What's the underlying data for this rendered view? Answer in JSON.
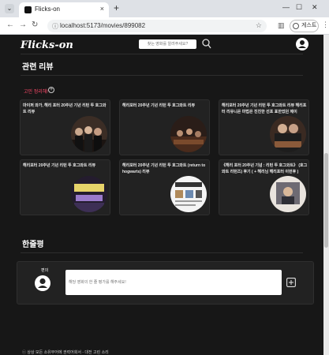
{
  "browser": {
    "tab_title": "Flicks-on",
    "url": "localhost:5173/movies/899082",
    "profile_label": "게스트",
    "lock_glyph": "ⓘ"
  },
  "site": {
    "logo": "Flicks-on",
    "search_placeholder": "찾는 영화를 알려주세요?"
  },
  "reviews": {
    "heading": "관련 리뷰",
    "filter_label": "고민 정리해!",
    "filter_add_glyph": "+",
    "cards": [
      {
        "title": "마이퍼 와가, 해리 포터 20주년 기년 리턴 투 호그와트 리뷰"
      },
      {
        "title": "해리포터 20주년 기년 리턴 투 호그와트 리뷰"
      },
      {
        "title": "해리포터 20주년 기년 리턴 투 호그와트 리뷰 해리포터 리유니온 마법은 진진한 선포 표한었던 제이"
      },
      {
        "title": "해리포터 20주년 기년 리턴 투 호그와트 리뷰"
      },
      {
        "title": "해리포터 20주년 기년 리턴 투 호그와트 (return to hogwarts) 리뷰"
      },
      {
        "title": "《해리 포터 20주년 기념 : 리턴 투 호그와트》 (호그와트 리턴즈) 후기 ( + 해리님 해리포터 이번후 )"
      }
    ]
  },
  "one_liner": {
    "heading": "한줄평",
    "user_name": "편의",
    "input_placeholder": "해당 영화의 한 줄 평가를 해주세요!"
  },
  "footer": {
    "text": "ⓒ 상상 모든 소유부어에 권력어회서 - 대전 고린 소리"
  },
  "colors": {
    "page_bg": "#171717",
    "card_bg": "#222222",
    "accent": "#ff4a6a"
  }
}
